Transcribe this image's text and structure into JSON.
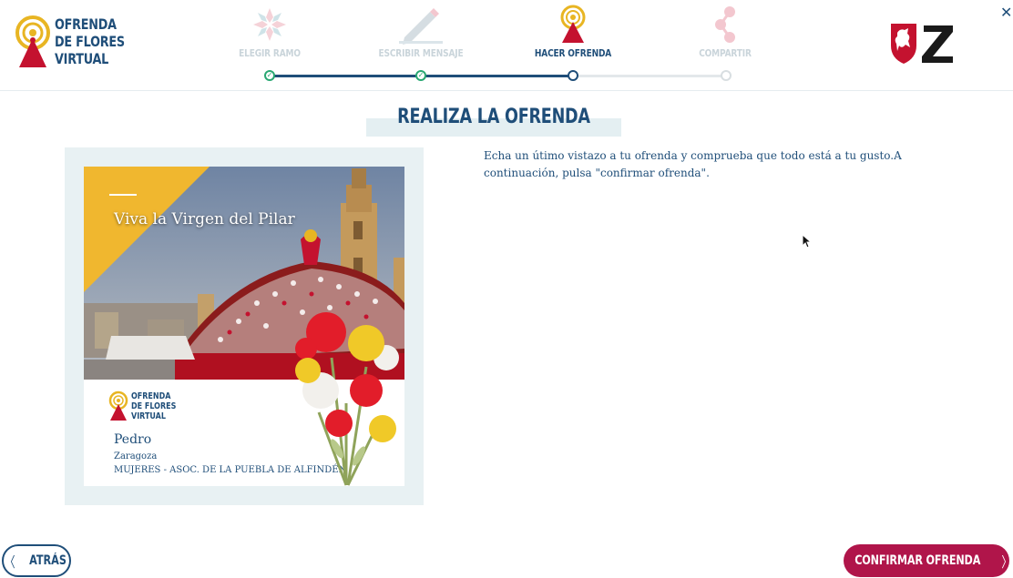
{
  "brand": {
    "line1": "OFRENDA",
    "line2": "DE FLORES",
    "line3": "VIRTUAL"
  },
  "steps": [
    {
      "label": "ELEGIR RAMO",
      "state": "done"
    },
    {
      "label": "ESCRIBIR MENSAJE",
      "state": "done"
    },
    {
      "label": "HACER OFRENDA",
      "state": "current"
    },
    {
      "label": "COMPARTIR",
      "state": "pending"
    }
  ],
  "title": "REALIZA LA OFRENDA",
  "instructions": "Echa un útimo vistazo a tu ofrenda y comprueba que todo está a tu gusto.A continuación, pulsa \"confirmar ofrenda\".",
  "card": {
    "message": "Viva la Virgen del Pilar",
    "logo_line1": "OFRENDA",
    "logo_line2": "DE FLORES",
    "logo_line3": "VIRTUAL",
    "name": "Pedro",
    "city": "Zaragoza",
    "group": "MUJERES - ASOC. DE LA PUEBLA DE ALFINDÉN"
  },
  "buttons": {
    "back": "ATRÁS",
    "confirm": "CONFIRMAR OFRENDA"
  },
  "colors": {
    "primary": "#1f4e79",
    "accent": "#b0154a",
    "done": "#2aa873",
    "gold": "#e8b523",
    "crimson": "#c4122f"
  },
  "icons": {
    "close": "close-icon",
    "back": "chevron-left-icon",
    "confirm": "chevron-right-icon"
  }
}
